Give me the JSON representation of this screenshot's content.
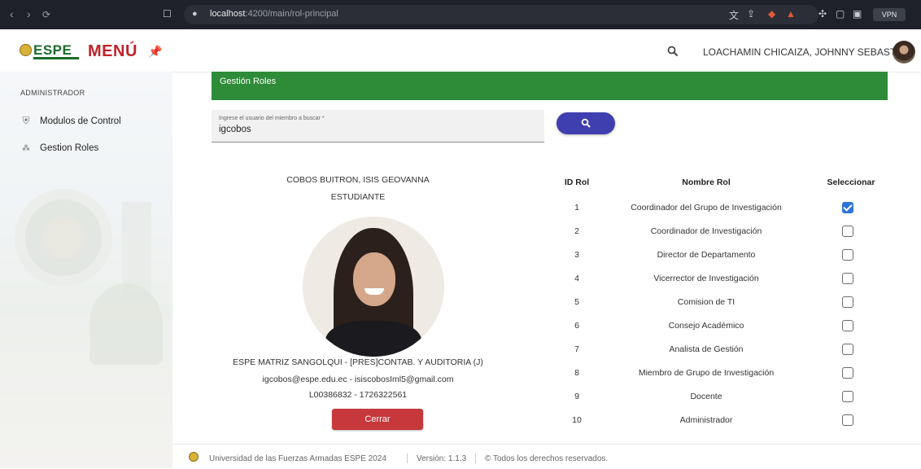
{
  "browser": {
    "url_host": "localhost",
    "url_path": ":4200/main/rol-principal",
    "vpn_label": "VPN"
  },
  "header": {
    "logo_text": "ESPE",
    "menu_title": "MENÚ",
    "user_name": "LOACHAMIN CHICAIZA, JOHNNY SEBASTIAN"
  },
  "sidebar": {
    "section": "ADMINISTRADOR",
    "items": [
      {
        "label": "Modulos de Control",
        "icon": "shield-icon"
      },
      {
        "label": "Gestion Roles",
        "icon": "users-icon"
      }
    ]
  },
  "main": {
    "banner_title": "Gestión Roles",
    "search": {
      "label": "Ingrese el usuario del miembro a buscar *",
      "value": "igcobos"
    }
  },
  "profile": {
    "name": "COBOS BUITRON, ISIS GEOVANNA",
    "role": "ESTUDIANTE",
    "campus": "ESPE MATRIZ SANGOLQUI - [PRES]CONTAB. Y AUDITORIA (J)",
    "emails": "igcobos@espe.edu.ec - isiscobosIml5@gmail.com",
    "ids": "L00386832 - 1726322561",
    "close_label": "Cerrar"
  },
  "table": {
    "headers": [
      "ID Rol",
      "Nombre Rol",
      "Seleccionar"
    ],
    "rows": [
      {
        "id": "1",
        "name": "Coordinador del Grupo de Investigación",
        "selected": true
      },
      {
        "id": "2",
        "name": "Coordinador de Investigación",
        "selected": false
      },
      {
        "id": "3",
        "name": "Director de Departamento",
        "selected": false
      },
      {
        "id": "4",
        "name": "Vicerrector de Investigación",
        "selected": false
      },
      {
        "id": "5",
        "name": "Comision de TI",
        "selected": false
      },
      {
        "id": "6",
        "name": "Consejo Académico",
        "selected": false
      },
      {
        "id": "7",
        "name": "Analista de Gestión",
        "selected": false
      },
      {
        "id": "8",
        "name": "Miembro de Grupo de Investigación",
        "selected": false
      },
      {
        "id": "9",
        "name": "Docente",
        "selected": false
      },
      {
        "id": "10",
        "name": "Administrador",
        "selected": false
      }
    ]
  },
  "footer": {
    "university": "Universidad de las Fuerzas Armadas ESPE 2024",
    "version": "Versión: 1.1.3",
    "rights": "© Todos los derechos reservados."
  },
  "colors": {
    "banner": "#2e8b38",
    "search_button": "#3f3fb0",
    "close_button": "#c6383b",
    "menu_title": "#c0232b",
    "checkbox_checked": "#2f73d8"
  }
}
